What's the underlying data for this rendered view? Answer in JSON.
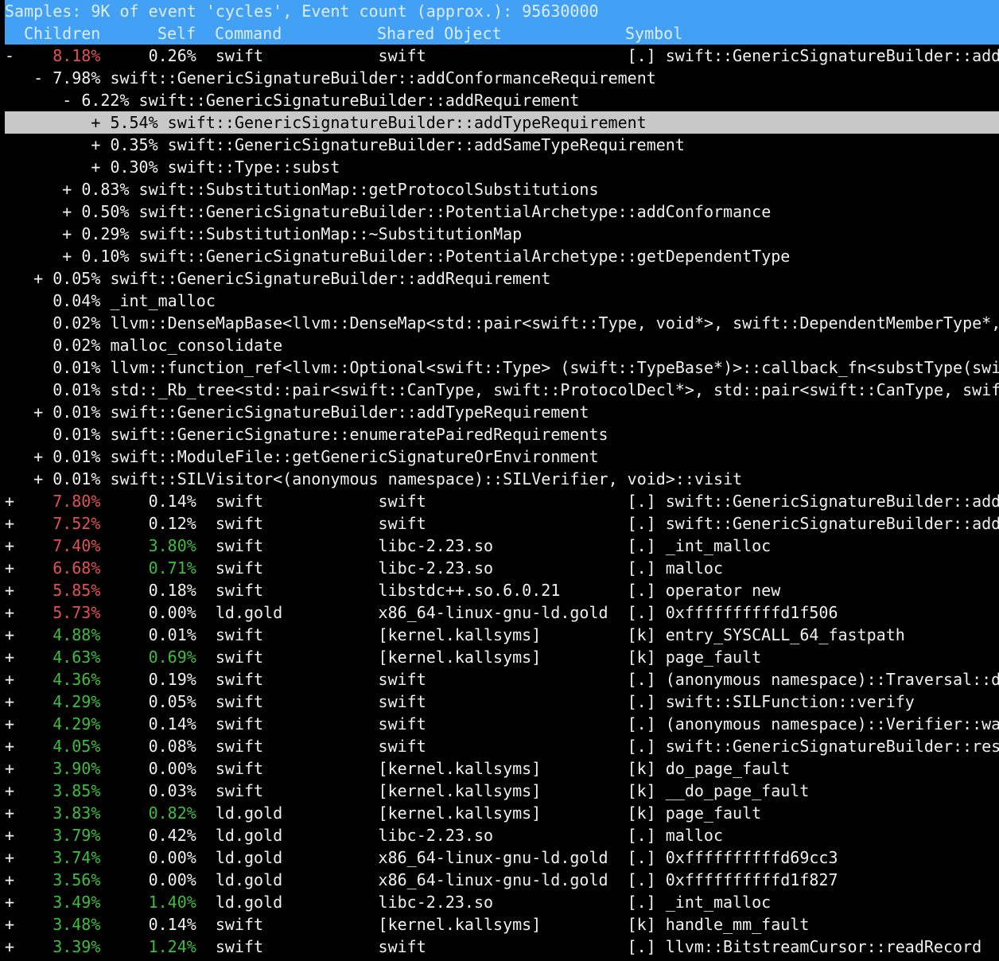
{
  "title": "Samples: 9K of event 'cycles', Event count (approx.): 95630000",
  "columns": [
    "Children",
    "Self",
    "Command",
    "Shared Object",
    "Symbol"
  ],
  "colors": {
    "header_bg": "#42a1f4",
    "selected_bg": "#c8c8c8",
    "high": "#e0524f",
    "medium": "#3cbf3c"
  },
  "rows": [
    {
      "kind": "top",
      "sign": "-",
      "children": "8.18%",
      "self": "0.26%",
      "command": "swift",
      "object": "swift",
      "type": "[.]",
      "symbol": "swift::GenericSignatureBuilder::addConformanceRequirement"
    },
    {
      "kind": "child",
      "depth": 1,
      "sign": "-",
      "pct": "7.98%",
      "symbol": "swift::GenericSignatureBuilder::addConformanceRequirement"
    },
    {
      "kind": "child",
      "depth": 2,
      "sign": "-",
      "pct": "6.22%",
      "symbol": "swift::GenericSignatureBuilder::addRequirement"
    },
    {
      "kind": "child",
      "depth": 3,
      "sign": "+",
      "pct": "5.54%",
      "symbol": "swift::GenericSignatureBuilder::addTypeRequirement",
      "selected": true
    },
    {
      "kind": "child",
      "depth": 3,
      "sign": "+",
      "pct": "0.35%",
      "symbol": "swift::GenericSignatureBuilder::addSameTypeRequirement"
    },
    {
      "kind": "child",
      "depth": 3,
      "sign": "+",
      "pct": "0.30%",
      "symbol": "swift::Type::subst"
    },
    {
      "kind": "child",
      "depth": 2,
      "sign": "+",
      "pct": "0.83%",
      "symbol": "swift::SubstitutionMap::getProtocolSubstitutions"
    },
    {
      "kind": "child",
      "depth": 2,
      "sign": "+",
      "pct": "0.50%",
      "symbol": "swift::GenericSignatureBuilder::PotentialArchetype::addConformance"
    },
    {
      "kind": "child",
      "depth": 2,
      "sign": "+",
      "pct": "0.29%",
      "symbol": "swift::SubstitutionMap::~SubstitutionMap"
    },
    {
      "kind": "child",
      "depth": 2,
      "sign": "+",
      "pct": "0.10%",
      "symbol": "swift::GenericSignatureBuilder::PotentialArchetype::getDependentType"
    },
    {
      "kind": "child",
      "depth": 1,
      "sign": "+",
      "pct": "0.05%",
      "symbol": "swift::GenericSignatureBuilder::addRequirement"
    },
    {
      "kind": "child",
      "depth": 1,
      "sign": "",
      "pct": "0.04%",
      "symbol": "_int_malloc"
    },
    {
      "kind": "child",
      "depth": 1,
      "sign": "",
      "pct": "0.02%",
      "symbol": "llvm::DenseMapBase<llvm::DenseMap<std::pair<swift::Type, void*>, swift::DependentMemberType*,"
    },
    {
      "kind": "child",
      "depth": 1,
      "sign": "",
      "pct": "0.02%",
      "symbol": "malloc_consolidate"
    },
    {
      "kind": "child",
      "depth": 1,
      "sign": "",
      "pct": "0.01%",
      "symbol": "llvm::function_ref<llvm::Optional<swift::Type> (swift::TypeBase*)>::callback_fn<substType(swi"
    },
    {
      "kind": "child",
      "depth": 1,
      "sign": "",
      "pct": "0.01%",
      "symbol": "std::_Rb_tree<std::pair<swift::CanType, swift::ProtocolDecl*>, std::pair<swift::CanType, swif"
    },
    {
      "kind": "child",
      "depth": 1,
      "sign": "+",
      "pct": "0.01%",
      "symbol": "swift::GenericSignatureBuilder::addTypeRequirement"
    },
    {
      "kind": "child",
      "depth": 1,
      "sign": "",
      "pct": "0.01%",
      "symbol": "swift::GenericSignature::enumeratePairedRequirements"
    },
    {
      "kind": "child",
      "depth": 1,
      "sign": "+",
      "pct": "0.01%",
      "symbol": "swift::ModuleFile::getGenericSignatureOrEnvironment"
    },
    {
      "kind": "child",
      "depth": 1,
      "sign": "+",
      "pct": "0.01%",
      "symbol": "swift::SILVisitor<(anonymous namespace)::SILVerifier, void>::visit"
    },
    {
      "kind": "top",
      "sign": "+",
      "children": "7.80%",
      "self": "0.14%",
      "command": "swift",
      "object": "swift",
      "type": "[.]",
      "symbol": "swift::GenericSignatureBuilder::addT"
    },
    {
      "kind": "top",
      "sign": "+",
      "children": "7.52%",
      "self": "0.12%",
      "command": "swift",
      "object": "swift",
      "type": "[.]",
      "symbol": "swift::GenericSignatureBuilder::addR"
    },
    {
      "kind": "top",
      "sign": "+",
      "children": "7.40%",
      "self": "3.80%",
      "command": "swift",
      "object": "libc-2.23.so",
      "type": "[.]",
      "symbol": "_int_malloc"
    },
    {
      "kind": "top",
      "sign": "+",
      "children": "6.68%",
      "self": "0.71%",
      "command": "swift",
      "object": "libc-2.23.so",
      "type": "[.]",
      "symbol": "malloc"
    },
    {
      "kind": "top",
      "sign": "+",
      "children": "5.85%",
      "self": "0.18%",
      "command": "swift",
      "object": "libstdc++.so.6.0.21",
      "type": "[.]",
      "symbol": "operator new"
    },
    {
      "kind": "top",
      "sign": "+",
      "children": "5.73%",
      "self": "0.00%",
      "command": "ld.gold",
      "object": "x86_64-linux-gnu-ld.gold",
      "type": "[.]",
      "symbol": "0xffffffffffd1f506"
    },
    {
      "kind": "top",
      "sign": "+",
      "children": "4.88%",
      "self": "0.01%",
      "command": "swift",
      "object": "[kernel.kallsyms]",
      "type": "[k]",
      "symbol": "entry_SYSCALL_64_fastpath"
    },
    {
      "kind": "top",
      "sign": "+",
      "children": "4.63%",
      "self": "0.69%",
      "command": "swift",
      "object": "[kernel.kallsyms]",
      "type": "[k]",
      "symbol": "page_fault"
    },
    {
      "kind": "top",
      "sign": "+",
      "children": "4.36%",
      "self": "0.19%",
      "command": "swift",
      "object": "swift",
      "type": "[.]",
      "symbol": "(anonymous namespace)::Traversal::do"
    },
    {
      "kind": "top",
      "sign": "+",
      "children": "4.29%",
      "self": "0.05%",
      "command": "swift",
      "object": "swift",
      "type": "[.]",
      "symbol": "swift::SILFunction::verify"
    },
    {
      "kind": "top",
      "sign": "+",
      "children": "4.29%",
      "self": "0.14%",
      "command": "swift",
      "object": "swift",
      "type": "[.]",
      "symbol": "(anonymous namespace)::Verifier::wal"
    },
    {
      "kind": "top",
      "sign": "+",
      "children": "4.05%",
      "self": "0.08%",
      "command": "swift",
      "object": "swift",
      "type": "[.]",
      "symbol": "swift::GenericSignatureBuilder::reso"
    },
    {
      "kind": "top",
      "sign": "+",
      "children": "3.90%",
      "self": "0.00%",
      "command": "swift",
      "object": "[kernel.kallsyms]",
      "type": "[k]",
      "symbol": "do_page_fault"
    },
    {
      "kind": "top",
      "sign": "+",
      "children": "3.85%",
      "self": "0.03%",
      "command": "swift",
      "object": "[kernel.kallsyms]",
      "type": "[k]",
      "symbol": "__do_page_fault"
    },
    {
      "kind": "top",
      "sign": "+",
      "children": "3.83%",
      "self": "0.82%",
      "command": "ld.gold",
      "object": "[kernel.kallsyms]",
      "type": "[k]",
      "symbol": "page_fault"
    },
    {
      "kind": "top",
      "sign": "+",
      "children": "3.79%",
      "self": "0.42%",
      "command": "ld.gold",
      "object": "libc-2.23.so",
      "type": "[.]",
      "symbol": "malloc"
    },
    {
      "kind": "top",
      "sign": "+",
      "children": "3.74%",
      "self": "0.00%",
      "command": "ld.gold",
      "object": "x86_64-linux-gnu-ld.gold",
      "type": "[.]",
      "symbol": "0xffffffffffd69cc3"
    },
    {
      "kind": "top",
      "sign": "+",
      "children": "3.56%",
      "self": "0.00%",
      "command": "ld.gold",
      "object": "x86_64-linux-gnu-ld.gold",
      "type": "[.]",
      "symbol": "0xffffffffffd1f827"
    },
    {
      "kind": "top",
      "sign": "+",
      "children": "3.49%",
      "self": "1.40%",
      "command": "ld.gold",
      "object": "libc-2.23.so",
      "type": "[.]",
      "symbol": "_int_malloc"
    },
    {
      "kind": "top",
      "sign": "+",
      "children": "3.48%",
      "self": "0.14%",
      "command": "swift",
      "object": "[kernel.kallsyms]",
      "type": "[k]",
      "symbol": "handle_mm_fault"
    },
    {
      "kind": "top",
      "sign": "+",
      "children": "3.39%",
      "self": "1.24%",
      "command": "swift",
      "object": "swift",
      "type": "[.]",
      "symbol": "llvm::BitstreamCursor::readRecord"
    }
  ]
}
